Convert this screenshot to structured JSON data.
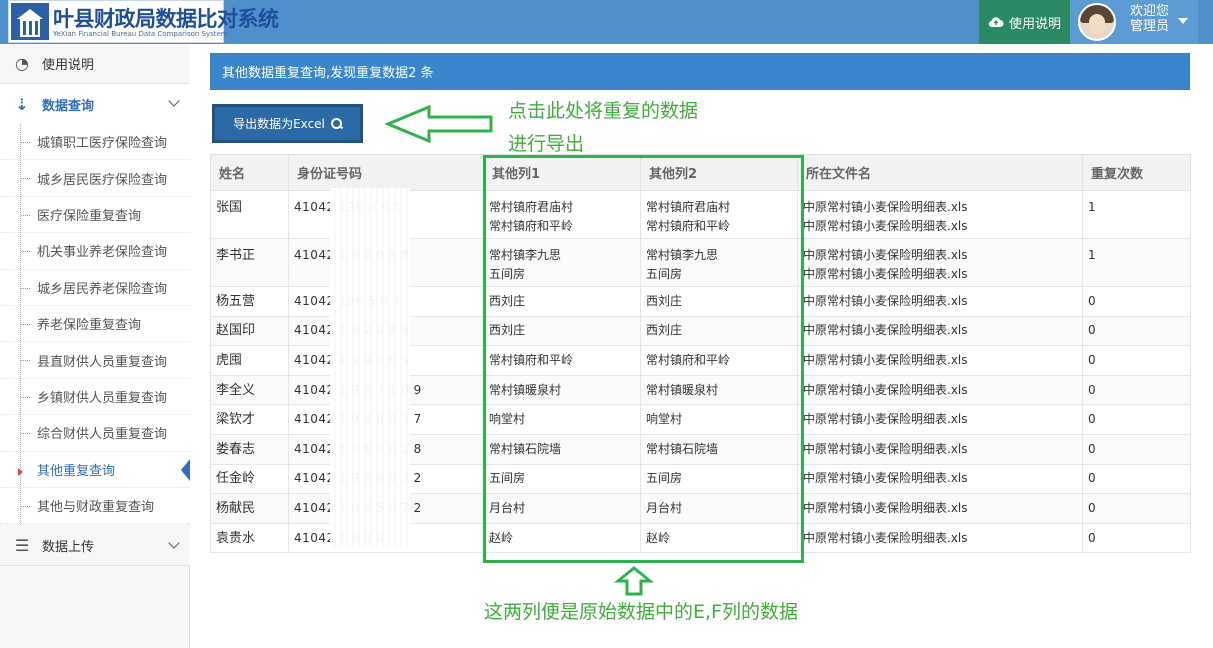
{
  "header": {
    "system_title": "叶县财政局数据比对系统",
    "system_subtitle": "YeXian Financial Bureau Data Comparison System",
    "help_label": "使用说明",
    "welcome_line1": "欢迎您",
    "welcome_line2": "管理员"
  },
  "sidebar": {
    "help": "使用说明",
    "data_query": "数据查询",
    "data_upload": "数据上传",
    "items": [
      "城镇职工医疗保险查询",
      "城乡居民医疗保险查询",
      "医疗保险重复查询",
      "机关事业养老保险查询",
      "城乡居民养老保险查询",
      "养老保险重复查询",
      "县直财供人员重复查询",
      "乡镇财供人员重复查询",
      "综合财供人员重复查询",
      "其他重复查询",
      "其他与财政重复查询"
    ]
  },
  "main": {
    "banner": "其他数据重复查询,发现重复数据2 条",
    "export_label": "导出数据为Excel",
    "annotation_export": "点击此处将重复的数据进行导出",
    "annotation_columns": "这两列便是原始数据中的E,F列的数据"
  },
  "table": {
    "headers": [
      "姓名",
      "身份证号码",
      "其他列1",
      "其他列2",
      "所在文件名",
      "重复次数"
    ],
    "rows": [
      {
        "name": "张国",
        "id": "41042 19€ /(  0 5",
        "c1": [
          "常村镇府君庙村",
          "常村镇府和平岭"
        ],
        "c2": [
          "常村镇府君庙村",
          "常村镇府和平岭"
        ],
        "files": [
          "中原常村镇小麦保险明细表.xls",
          "中原常村镇小麦保险明细表.xls"
        ],
        "count": "1"
      },
      {
        "name": "李书正",
        "id": "41042 1 9 8 0 9 8",
        "c1": [
          "常村镇李九思",
          "五间房"
        ],
        "c2": [
          "常村镇李九思",
          "五间房"
        ],
        "files": [
          "中原常村镇小麦保险明细表.xls",
          "中原常村镇小麦保险明细表.xls"
        ],
        "count": "1"
      },
      {
        "name": "杨五营",
        "id": "41042 19€ 5 0 4",
        "c1": [
          "西刘庄"
        ],
        "c2": [
          "西刘庄"
        ],
        "files": [
          "中原常村镇小麦保险明细表.xls"
        ],
        "count": "0"
      },
      {
        "name": "赵国印",
        "id": "41042 1 9 2 0 9 8",
        "c1": [
          "西刘庄"
        ],
        "c2": [
          "西刘庄"
        ],
        "files": [
          "中原常村镇小麦保险明细表.xls"
        ],
        "count": "0"
      },
      {
        "name": "虎囤",
        "id": "41042 1 9 4 8 0 5",
        "c1": [
          "常村镇府和平岭"
        ],
        "c2": [
          "常村镇府和平岭"
        ],
        "files": [
          "中原常村镇小麦保险明细表.xls"
        ],
        "count": "0"
      },
      {
        "name": "李全义",
        "id": "41042 1 9 6 7 1 0 9",
        "c1": [
          "常村镇暖泉村"
        ],
        "c2": [
          "常村镇暖泉村"
        ],
        "files": [
          "中原常村镇小麦保险明细表.xls"
        ],
        "count": "0"
      },
      {
        "name": "梁钦才",
        "id": "41042 1 9 4 8 0 3 7",
        "c1": [
          "响堂村"
        ],
        "c2": [
          "响堂村"
        ],
        "files": [
          "中原常村镇小麦保险明细表.xls"
        ],
        "count": "0"
      },
      {
        "name": "娄春志",
        "id": "41042 1 9 6 8 0 1 8",
        "c1": [
          "常村镇石院墙"
        ],
        "c2": [
          "常村镇石院墙"
        ],
        "files": [
          "中原常村镇小麦保险明细表.xls"
        ],
        "count": "0"
      },
      {
        "name": "任金岭",
        "id": "41042 1 9 6 6 0 3 2",
        "c1": [
          "五间房"
        ],
        "c2": [
          "五间房"
        ],
        "files": [
          "中原常村镇小麦保险明细表.xls"
        ],
        "count": "0"
      },
      {
        "name": "杨献民",
        "id": "41042 1 9 6 5 0 7 2",
        "c1": [
          "月台村"
        ],
        "c2": [
          "月台村"
        ],
        "files": [
          "中原常村镇小麦保险明细表.xls"
        ],
        "count": "0"
      },
      {
        "name": "袁贵水",
        "id": "41042 1 9 4 0",
        "c1": [
          "赵岭"
        ],
        "c2": [
          "赵岭"
        ],
        "files": [
          "中原常村镇小麦保险明细表.xls"
        ],
        "count": "0"
      }
    ]
  },
  "colors": {
    "header_bg": "#4f8fcc",
    "help_btn": "#2b8a63",
    "banner": "#3a85cc",
    "annotation": "#3fae3a",
    "highlight": "#2eb34a"
  }
}
